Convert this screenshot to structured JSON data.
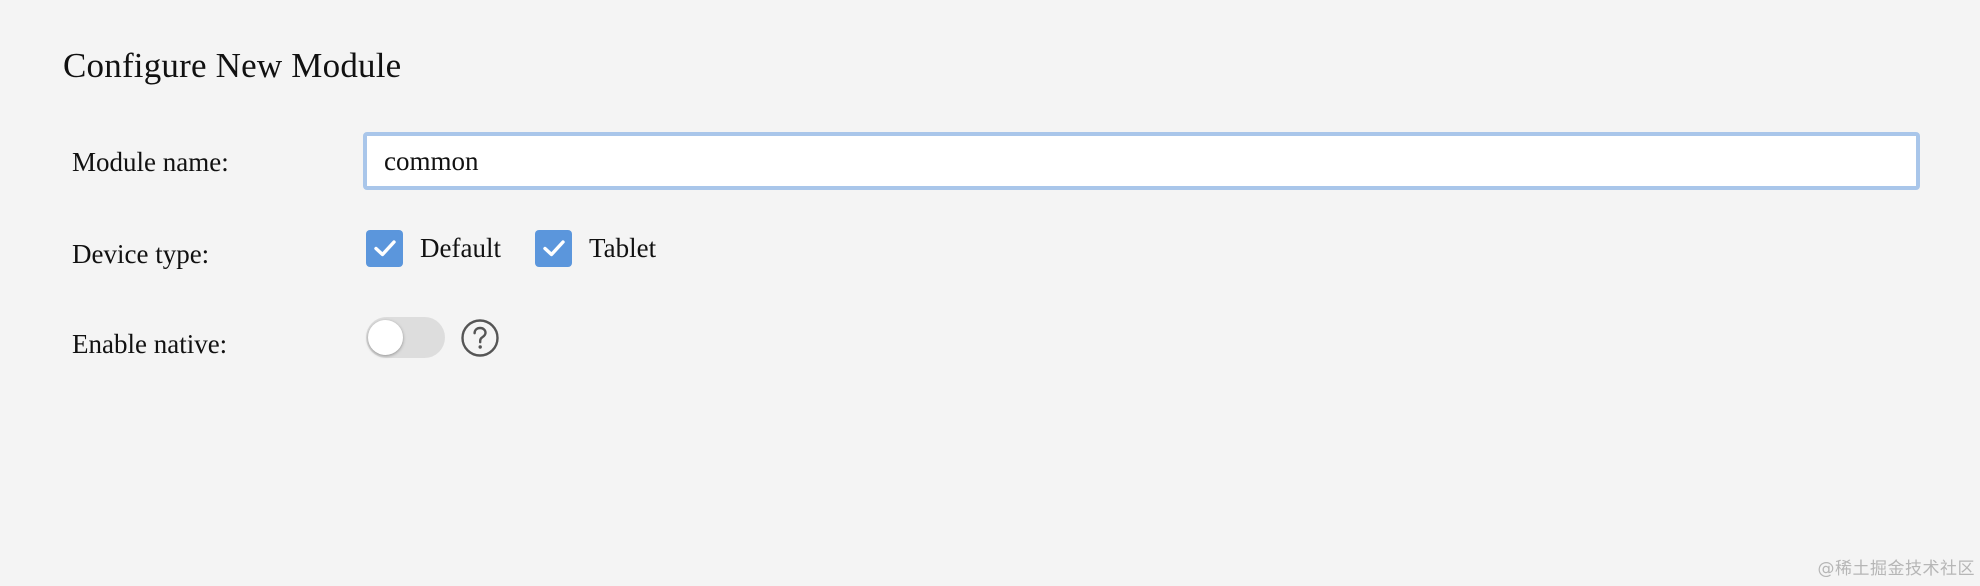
{
  "page": {
    "title": "Configure New Module"
  },
  "module_name": {
    "label": "Module name:",
    "value": "common"
  },
  "device_type": {
    "label": "Device type:",
    "options": [
      {
        "label": "Default",
        "checked": true
      },
      {
        "label": "Tablet",
        "checked": true
      }
    ]
  },
  "enable_native": {
    "label": "Enable native:",
    "enabled": false,
    "help_icon": "question-circle-icon"
  },
  "watermark": "@稀土掘金技术社区",
  "colors": {
    "background": "#f4f4f4",
    "accent": "#5b96dc",
    "input_focus_border": "#a9c6ea",
    "toggle_off": "#dddddd"
  }
}
